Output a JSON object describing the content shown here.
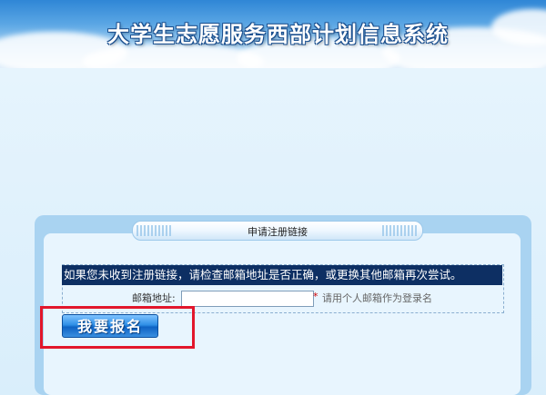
{
  "header": {
    "title": "大学生志愿服务西部计划信息系统"
  },
  "panel": {
    "title": "申请注册链接"
  },
  "form": {
    "notice": "如果您未收到注册链接，请检查邮箱地址是否正确，或更换其他邮箱再次尝试。",
    "email_label": "邮箱地址:",
    "email_value": "",
    "email_placeholder": "",
    "required_mark": "*",
    "email_hint": "请用个人邮箱作为登录名",
    "submit_label": "我要报名"
  },
  "colors": {
    "notice_bg": "#0d2f63",
    "highlight": "#e2162b",
    "button": "#2f8fe6"
  }
}
